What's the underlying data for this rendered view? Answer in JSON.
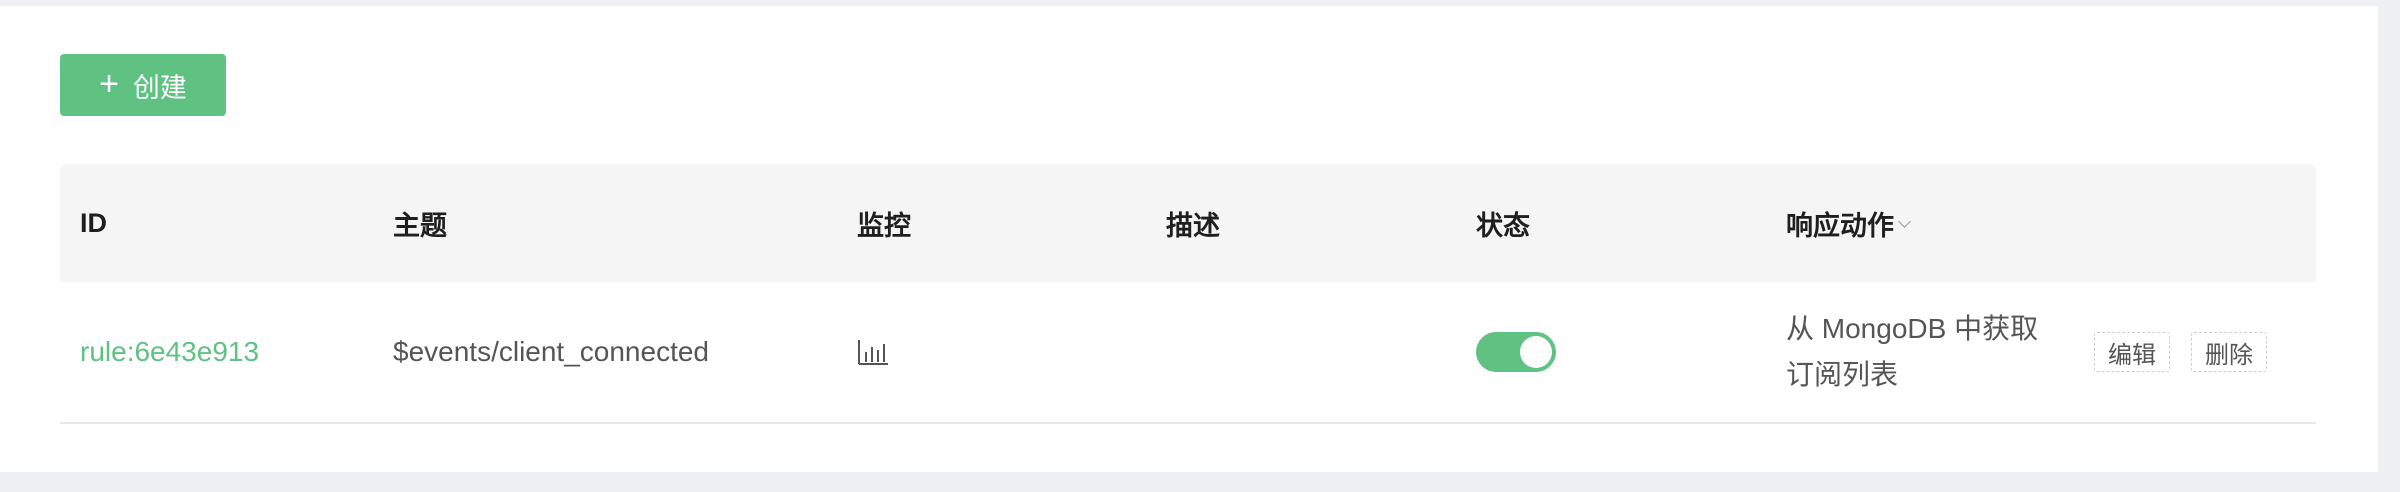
{
  "toolbar": {
    "create_label": "创建",
    "create_icon": "plus-icon"
  },
  "table": {
    "columns": [
      "ID",
      "主题",
      "监控",
      "描述",
      "状态",
      "响应动作"
    ],
    "rows": [
      {
        "id": "rule:6e43e913",
        "topic": "$events/client_connected",
        "monitor_icon": "bar-chart-icon",
        "description": "",
        "enabled": true,
        "action_line1": "从 MongoDB 中获取",
        "action_line2": "订阅列表",
        "edit_label": "编辑",
        "delete_label": "删除"
      }
    ]
  },
  "colors": {
    "accent": "#5fc283",
    "header_bg": "#f5f5f5",
    "page_bg": "#eff0f4"
  }
}
